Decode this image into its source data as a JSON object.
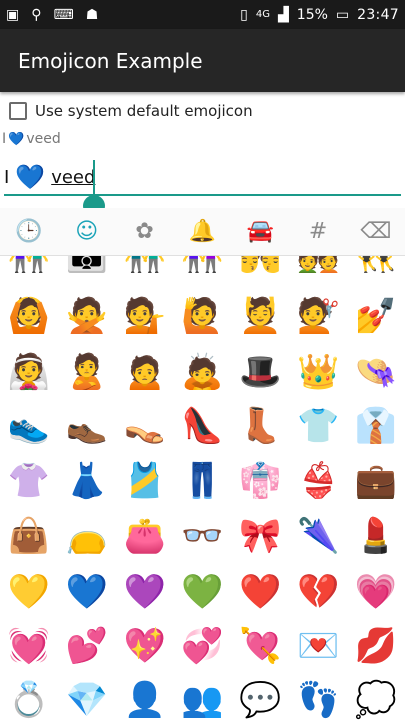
{
  "status": {
    "battery": "15%",
    "time": "23:47",
    "signal_label": "4G"
  },
  "app": {
    "title": "Emojicon Example"
  },
  "options": {
    "use_system_label": "Use system default emojicon"
  },
  "preview": {
    "prefix": "I",
    "emoji": "💙",
    "word": "veed"
  },
  "editor": {
    "prefix": "I",
    "emoji": "💙",
    "word": "veed"
  },
  "tabs": [
    {
      "name": "recent",
      "icon": "clock-icon",
      "glyph": "🕒"
    },
    {
      "name": "people",
      "icon": "smiley-icon",
      "glyph": "☺"
    },
    {
      "name": "nature",
      "icon": "flower-gear-icon",
      "glyph": "✿"
    },
    {
      "name": "objects",
      "icon": "bell-icon",
      "glyph": "🔔"
    },
    {
      "name": "places",
      "icon": "car-icon",
      "glyph": "🚘"
    },
    {
      "name": "symbols",
      "icon": "hash-icon",
      "glyph": "#"
    },
    {
      "name": "backspace",
      "icon": "backspace-icon",
      "glyph": "⌫"
    }
  ],
  "emoji_rows": [
    [
      "👫",
      "👪",
      "👬",
      "👭",
      "💏",
      "💑",
      "👯"
    ],
    [
      "🙆",
      "🙅",
      "💁",
      "🙋",
      "💆",
      "💇",
      "💅"
    ],
    [
      "👰",
      "🙎",
      "🙍",
      "🙇",
      "🎩",
      "👑",
      "👒"
    ],
    [
      "👟",
      "👞",
      "👡",
      "👠",
      "👢",
      "👕",
      "👔"
    ],
    [
      "👚",
      "👗",
      "🎽",
      "👖",
      "👘",
      "👙",
      "💼"
    ],
    [
      "👜",
      "👝",
      "👛",
      "👓",
      "🎀",
      "🌂",
      "💄"
    ],
    [
      "💛",
      "💙",
      "💜",
      "💚",
      "❤️",
      "💔",
      "💗"
    ],
    [
      "💓",
      "💕",
      "💖",
      "💞",
      "💘",
      "💌",
      "💋"
    ],
    [
      "💍",
      "💎",
      "👤",
      "👥",
      "💬",
      "👣",
      "💭"
    ]
  ]
}
